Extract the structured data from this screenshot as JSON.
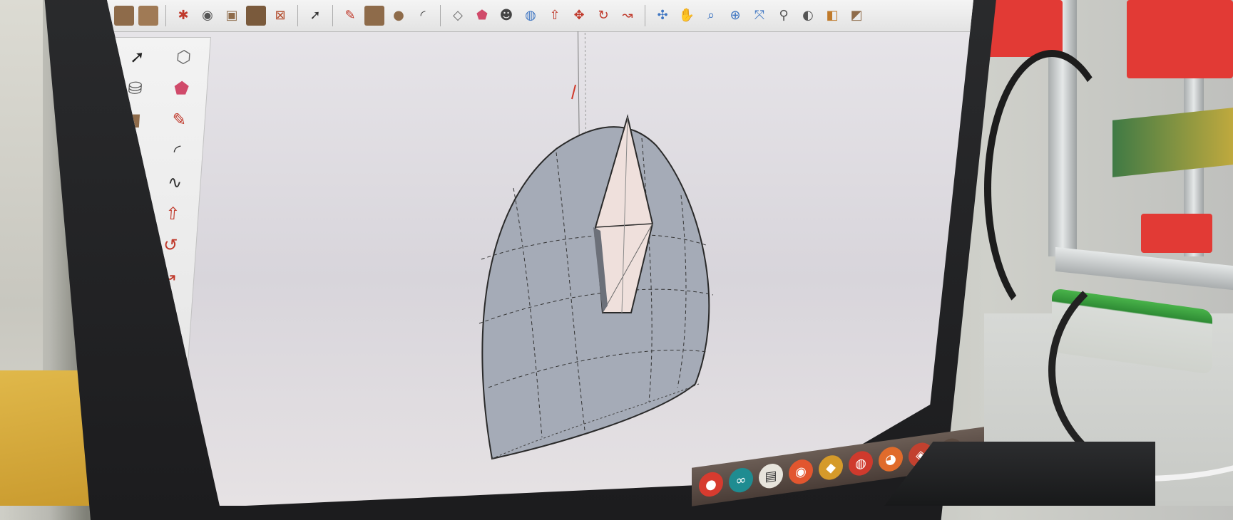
{
  "scene": {
    "description_free": true,
    "colors": {
      "accent_red": "#e23a35",
      "egg_fill": "#a5abb7",
      "facet_fill": "#efe0dc",
      "screen_bg": "#e2dfe4"
    }
  },
  "toolbar_top": {
    "icons": [
      "box-icon",
      "box-open-icon",
      "stamp-icon",
      "camera-icon",
      "frame-icon",
      "texture-icon",
      "crossed-box-icon",
      "select-arrow-icon",
      "pencil-icon",
      "rectangle-icon",
      "circle-icon",
      "arc-icon",
      "eraser-icon",
      "paint-bucket-icon",
      "user-icon",
      "globe-icon",
      "push-pull-icon",
      "move-icon",
      "rotate-icon",
      "follow-me-icon",
      "offset-icon",
      "orbit-icon",
      "zoom-icon",
      "zoom-window-icon",
      "zoom-extents-icon",
      "walk-icon",
      "look-around-icon",
      "section-icon",
      "shadow-icon",
      "fog-icon",
      "style-icon",
      "layer-icon",
      "camera2-icon"
    ]
  },
  "toolbar_left": {
    "tools": [
      "select-icon",
      "make-component-icon",
      "paint-bucket-icon",
      "eraser-icon",
      "rectangle-icon",
      "pencil-icon",
      "circle-icon",
      "arc-icon",
      "polygon-icon",
      "freehand-icon",
      "move-icon",
      "push-pull-icon",
      "rotate-icon",
      "follow-me-icon",
      "scale-icon",
      "offset-icon",
      "tape-measure-icon",
      "dimension-icon",
      "protractor-icon",
      "text-icon",
      "axes-icon",
      "3d-text-icon",
      "orbit-icon",
      "pan-icon",
      "zoom-icon",
      "zoom-window-icon",
      "previous-view-icon",
      "zoom-extents-icon",
      "position-camera-icon",
      "look-around-icon",
      "walk-icon",
      "section-plane-icon"
    ]
  },
  "taskbar": {
    "icons": [
      "app-red-icon",
      "arduino-icon",
      "notes-icon",
      "app-orange-icon",
      "app-yellow-icon",
      "app-red2-icon",
      "firefox-icon",
      "app-red3-icon",
      "app-dark-icon",
      "app-red4-icon"
    ]
  }
}
